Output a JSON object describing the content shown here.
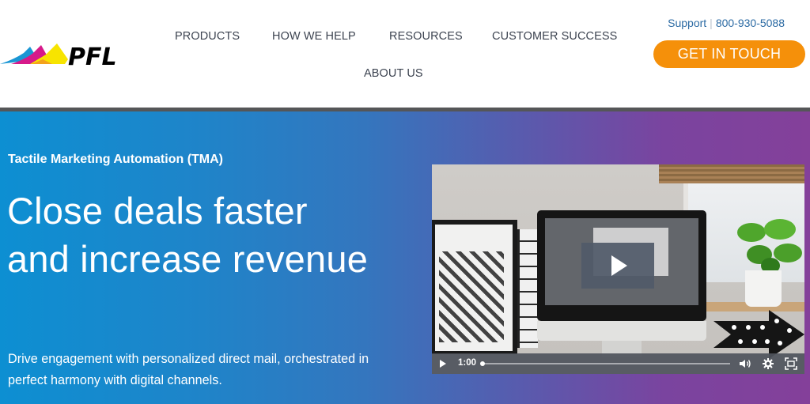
{
  "header": {
    "logo_text": "PFL",
    "nav": [
      {
        "label": "PRODUCTS"
      },
      {
        "label": "HOW WE HELP"
      },
      {
        "label": "RESOURCES"
      },
      {
        "label": "CUSTOMER SUCCESS"
      },
      {
        "label": "ABOUT US"
      }
    ],
    "support_label": "Support",
    "support_separator": "|",
    "phone": "800-930-5088",
    "cta_label": "GET IN TOUCH"
  },
  "hero": {
    "eyebrow": "Tactile Marketing Automation (TMA)",
    "headline": "Close deals faster and increase revenue",
    "subtext": "Drive engagement with personalized direct mail, orchestrated in perfect harmony with digital channels."
  },
  "video": {
    "current_time": "1:00",
    "progress_fraction": 0.0,
    "icons": {
      "play": "play-icon",
      "volume": "volume-icon",
      "settings": "gear-icon",
      "fullscreen": "fullscreen-icon"
    }
  },
  "colors": {
    "cta": "#f5900a",
    "support_link": "#2b6aa3",
    "nav_text": "#3d4451",
    "hero_gradient_start": "#0d8fd2",
    "hero_gradient_end": "#84409a",
    "divider": "#555658"
  }
}
